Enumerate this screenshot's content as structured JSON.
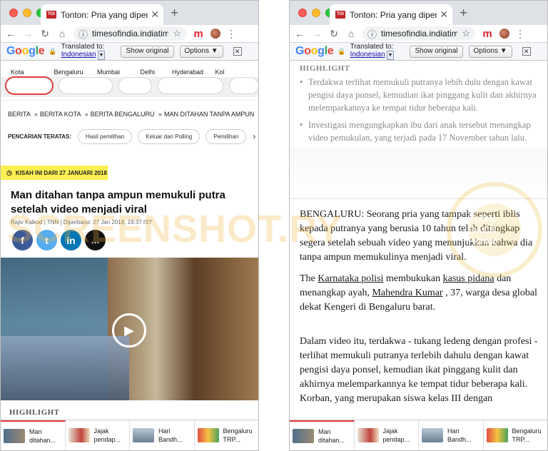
{
  "browser": {
    "tab_title": "Tonton: Pria yang dipenjara tanpa ampun memukuli putra setelah video menjadi viral",
    "favicon_text": "TOI",
    "url": "timesofindia.indiatimes.com",
    "close_glyph": "✕",
    "newtab_glyph": "+"
  },
  "translate_bar": {
    "logo_letters": [
      "G",
      "o",
      "o",
      "g",
      "l",
      "e"
    ],
    "translated_to": "Translated to:",
    "language": "Indonesian",
    "show_original": "Show original",
    "options": "Options ▼",
    "close": "✕"
  },
  "left_page": {
    "cities": [
      "Kota",
      "Bengaluru",
      "Mumbai",
      "Delhi",
      "Hyderabad",
      "Kol"
    ],
    "breadcrumbs": [
      "BERITA",
      "BERITA KOTA",
      "BERITA BENGALURU",
      "MAN DITAHAN TANPA AMPUN"
    ],
    "breadcrumb_sep": "»",
    "search_label": "PENCARIAN TERATAS:",
    "search_chips": [
      "Hasil pemilihan",
      "Keluar dari Polling",
      "Pemilihan"
    ],
    "story_badge": "KISAH INI DARI 27 JANUARI 2018",
    "headline": "Man ditahan tanpa ampun memukuli putra setelah video menjadi viral",
    "byline": "Rajiv Kalkod | TNN | Diperbarui: 27 Jan 2018, 19:37 IST",
    "share_icons": [
      "f",
      "t",
      "in",
      "…"
    ],
    "highlight_label": "HIGHLIGHT"
  },
  "right_page": {
    "highlight_label": "HIGHLIGHT",
    "bullets": [
      "Terdakwa terlihat memukuli putranya lebih dulu dengan kawat pengisi daya ponsel, kemudian ikat pinggang kulit dan akhirnya melemparkannya ke tempat tidur beberapa kali.",
      "Investigasi mengungkapkan ibu dari anak tersebut menangkap video pemukulan, yang terjadi pada 17 November tahun lalu."
    ],
    "para1": "BENGALURU: Seorang pria yang tampak seperti iblis kepada putranya yang berusia 10 tahun telah ditangkap segera setelah sebuah video yang menunjukkan bahwa dia tanpa ampun memukulinya menjadi viral.",
    "para2": {
      "t1": "The ",
      "link1": "Karnataka polisi",
      "t2": " membukukan ",
      "link2": "kasus pidana",
      "t3": " dan menangkap ayah, ",
      "link3": "Mahendra Kumar",
      "t4": " , 37, warga desa global dekat Kengeri di Bengaluru barat."
    },
    "para3": "Dalam video itu, terdakwa - tukang ledeng dengan profesi - terlihat memukuli putranya terlebih dahulu dengan kawat pengisi daya ponsel, kemudian ikat pinggang kulit dan akhirnya melemparkannya ke tempat tidur beberapa kali. Korban, yang merupakan siswa kelas III dengan"
  },
  "bottom_nav": [
    {
      "line1": "Man",
      "line2": "ditahan..."
    },
    {
      "line1": "Jajak",
      "line2": "pendap..."
    },
    {
      "line1": "Hari",
      "line2": "Bandh..."
    },
    {
      "line1": "Bengaluru",
      "line2": "TRP..."
    }
  ],
  "watermark": "SCREENSHOT.RY",
  "seal_text": "TURN BACK HOAX"
}
